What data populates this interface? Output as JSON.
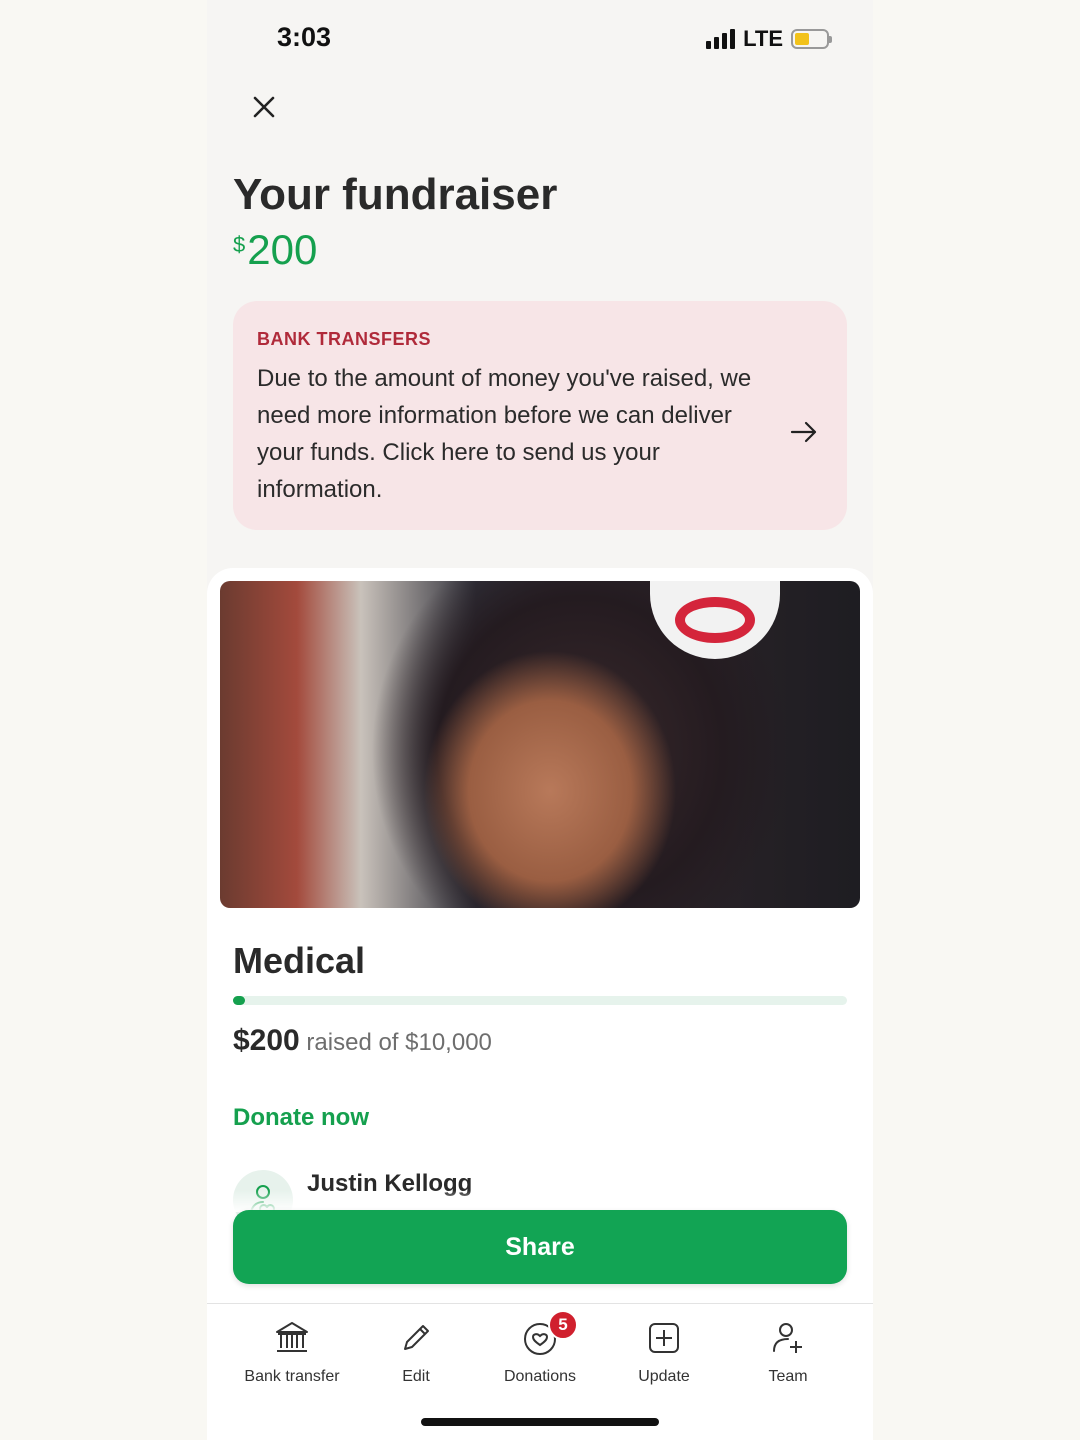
{
  "status_bar": {
    "time": "3:03",
    "network": "LTE"
  },
  "header": {
    "title": "Your fundraiser",
    "currency": "$",
    "total": "200"
  },
  "alert": {
    "label": "BANK TRANSFERS",
    "text": "Due to the amount of money you've raised, we need more information before we can deliver your funds. Click here to send us your information."
  },
  "campaign": {
    "title": "Medical",
    "raised_amount": "$200",
    "raised_text": "raised of $10,000",
    "progress_fraction": 0.02,
    "donate_label": "Donate now",
    "organizer": "Justin Kellogg"
  },
  "share_label": "Share",
  "tabs": [
    {
      "label": "Bank transfer",
      "icon": "bank-icon"
    },
    {
      "label": "Edit",
      "icon": "pencil-icon"
    },
    {
      "label": "Donations",
      "icon": "heart-icon",
      "badge": "5"
    },
    {
      "label": "Update",
      "icon": "plus-square-icon"
    },
    {
      "label": "Team",
      "icon": "add-person-icon"
    }
  ],
  "colors": {
    "accent": "#15a04e",
    "alert_bg": "#f7e5e7",
    "alert_label": "#b02a3a",
    "badge": "#d0202e"
  }
}
